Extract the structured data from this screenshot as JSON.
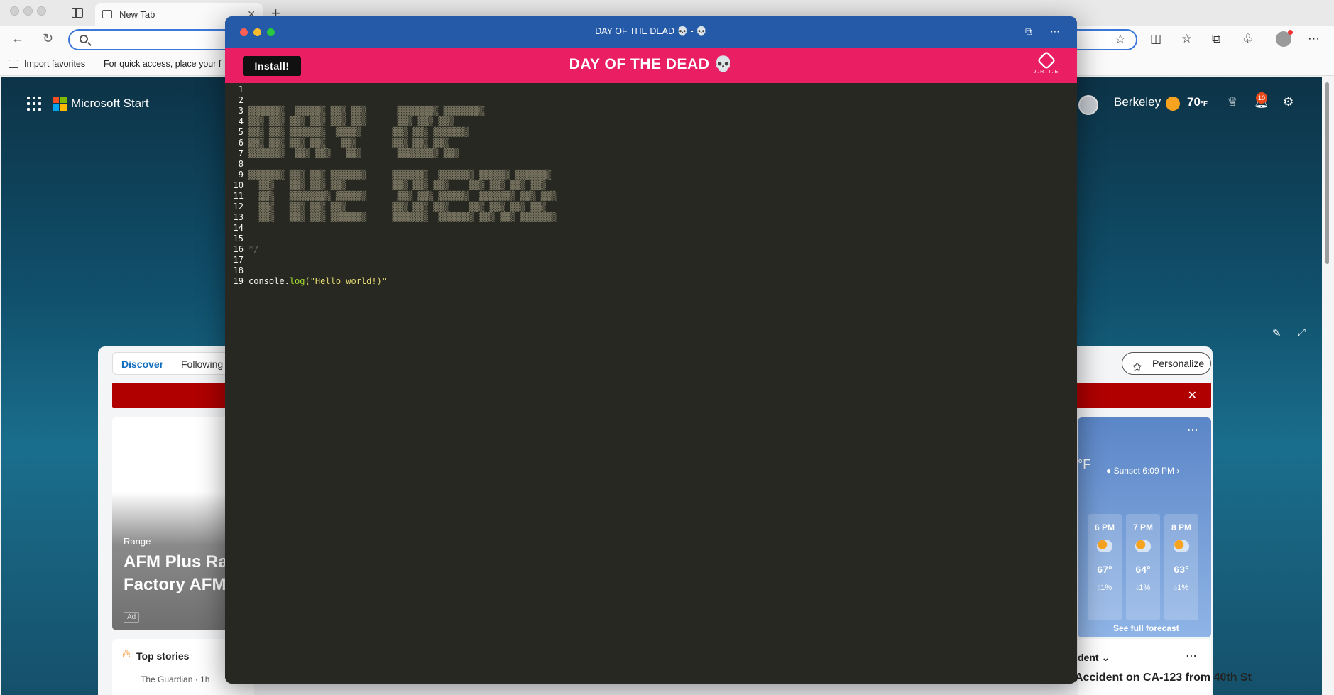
{
  "browser": {
    "tab_title": "New Tab",
    "new_tab_symbol": "+",
    "close_symbol": "✕",
    "favorites": {
      "import_label": "Import favorites",
      "quick_access_text": "For quick access, place your f"
    }
  },
  "msstart": {
    "brand": "Microsoft Start",
    "location": "Berkeley",
    "temperature": "70",
    "temp_unit": "°F",
    "notifications": "10",
    "feed_tabs": [
      "Discover",
      "Following"
    ],
    "personalize_label": "Personalize",
    "ad_card": {
      "category": "Range",
      "headline_1": "AFM Plus Ra",
      "headline_2": "Factory AFM",
      "ad_label": "Ad"
    },
    "top_stories": {
      "title": "Top stories",
      "source": "The Guardian · 1h"
    },
    "weather_card": {
      "unit": "°F",
      "sunset": "Sunset 6:09 PM",
      "hours": [
        {
          "time": "6 PM",
          "temp": "67°",
          "precip": "1%"
        },
        {
          "time": "7 PM",
          "temp": "64°",
          "precip": "1%"
        },
        {
          "time": "8 PM",
          "temp": "63°",
          "precip": "1%"
        }
      ],
      "full_forecast": "See full forecast"
    },
    "traffic": {
      "heading": "dent",
      "story": "Accident on CA-123 from 40th St"
    }
  },
  "app": {
    "window_title": "DAY OF THE DEAD 💀 - 💀",
    "install_label": "Install!",
    "header_title": "DAY OF THE DEAD 💀",
    "logo_text": "J.R.T.E",
    "editor": {
      "line_numbers": [
        "1",
        "2",
        "3",
        "4",
        "5",
        "6",
        "7",
        "8",
        "9",
        "10",
        "11",
        "12",
        "13",
        "14",
        "15",
        "16",
        "17",
        "18",
        "19"
      ],
      "comment_open": "/*",
      "comment_close": "*/",
      "code_object": "console.",
      "code_method": "log",
      "code_args": "(\"Hello world!)\""
    }
  },
  "colors": {
    "titlebar": "#245aa8",
    "header": "#e91e63",
    "editor_bg": "#272822",
    "comment": "#75715e",
    "function": "#a6e22e",
    "string": "#e6db74"
  }
}
